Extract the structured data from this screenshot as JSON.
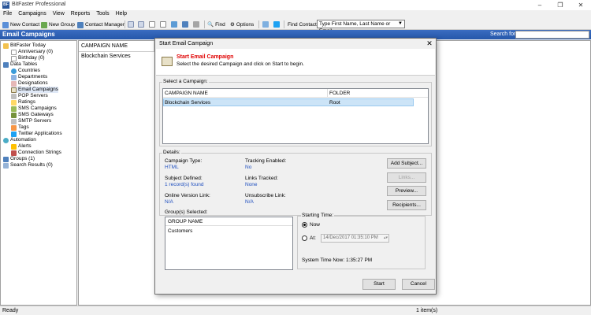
{
  "window": {
    "title": "BitFaster Professional",
    "minimize": "–",
    "maximize": "❐",
    "close": "✕"
  },
  "menu": [
    "File",
    "Campaigns",
    "View",
    "Reports",
    "Tools",
    "Help"
  ],
  "toolbar": {
    "new_contact": "New Contact",
    "new_group": "New Group",
    "contact_manager": "Contact Manager",
    "find": "Find",
    "options": "Options",
    "find_contact_label": "Find Contact:",
    "find_contact_value": "Type First Name, Last Name or Email"
  },
  "section": {
    "title": "Email Campaigns",
    "search_label": "Search for:"
  },
  "tree": [
    "BitFaster Today",
    "Anniversary (0)",
    "Birthday (0)",
    "Data Tables",
    "Countries",
    "Departments",
    "Designations",
    "Email Campaigns",
    "POP Servers",
    "Ratings",
    "SMS Campaigns",
    "SMS Gateways",
    "SMTP Servers",
    "Tags",
    "Twitter Applications",
    "Automation",
    "Alerts",
    "Connection Strings",
    "Groups (1)",
    "Search Results (0)"
  ],
  "list": {
    "column": "CAMPAIGN NAME",
    "row": "Blockchain Services"
  },
  "status": {
    "left": "Ready",
    "right": "1 item(s)"
  },
  "dialog": {
    "title": "Start Email Campaign",
    "close": "✕",
    "header_title": "Start Email Campaign",
    "header_subtitle": "Select the desired Campaign and click on Start to begin.",
    "select_label": "Select a Campaign:",
    "col_name": "CAMPAIGN NAME",
    "col_folder": "FOLDER",
    "row_name": "Blockchain Services",
    "row_folder": "Root",
    "details_label": "Details:",
    "campaign_type_label": "Campaign Type:",
    "campaign_type": "HTML",
    "tracking_label": "Tracking Enabled:",
    "tracking": "No",
    "subject_label": "Subject Defined:",
    "subject": "1 record(s) found",
    "links_label": "Links Tracked:",
    "links": "None",
    "online_label": "Online Version Link:",
    "online": "N/A",
    "unsub_label": "Unsubscribe Link:",
    "unsub": "N/A",
    "btn_add_subject": "Add Subject...",
    "btn_links": "Links...",
    "btn_preview": "Preview...",
    "btn_recipients": "Recipients...",
    "groups_label": "Group(s) Selected:",
    "group_col": "GROUP NAME",
    "group_row": "Customers",
    "start_time_label": "Starting Time:",
    "radio_now": "Now",
    "radio_at": "At:",
    "at_value": "14/Dec/2017 01:35:10 PM",
    "system_time": "System Time Now:   1:35:27 PM",
    "btn_start": "Start",
    "btn_cancel": "Cancel"
  }
}
